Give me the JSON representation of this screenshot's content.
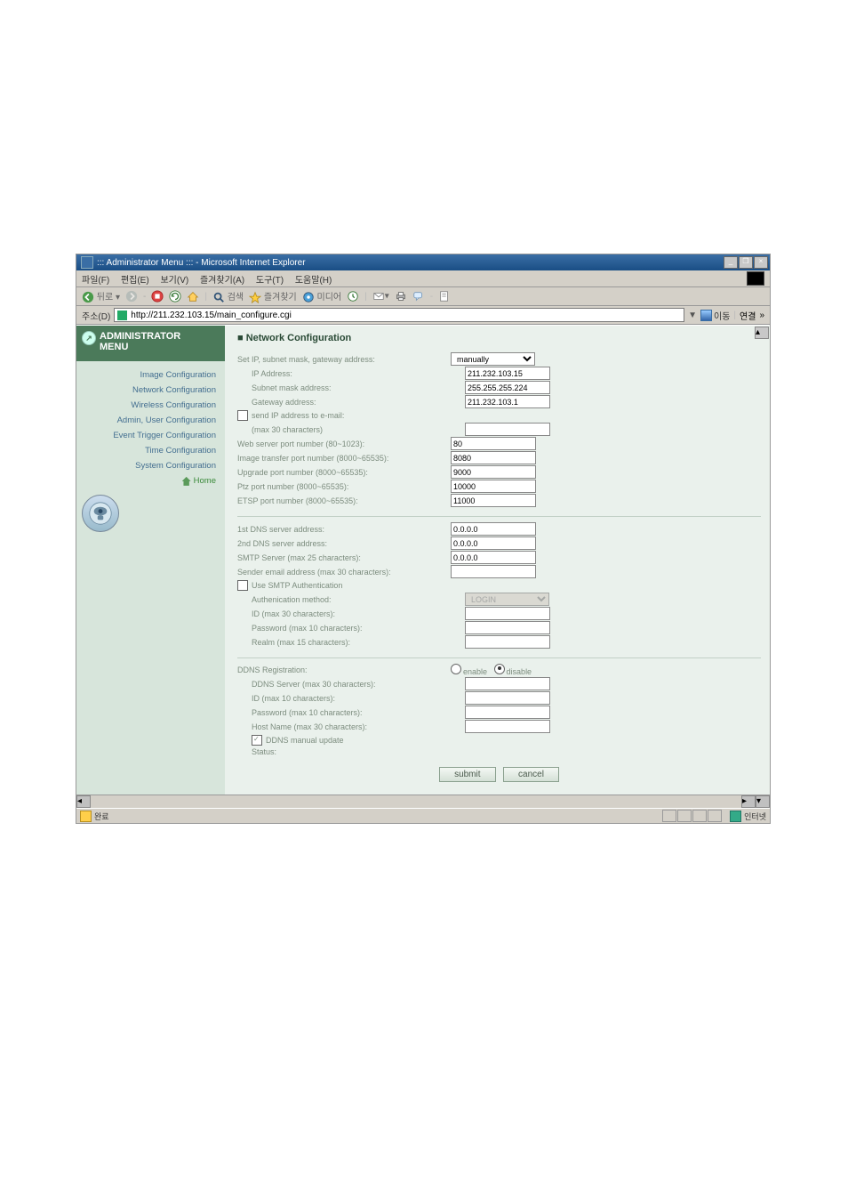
{
  "window": {
    "title": "::: Administrator Menu ::: - Microsoft Internet Explorer",
    "minimize": "_",
    "maximize": "❐",
    "close": "×"
  },
  "menu": {
    "file": "파일(F)",
    "edit": "편집(E)",
    "view": "보기(V)",
    "favorites": "즐겨찾기(A)",
    "tools": "도구(T)",
    "help": "도움말(H)"
  },
  "toolbar": {
    "back": "뒤로",
    "search": "검색",
    "favorites": "즐겨찾기",
    "media": "미디어"
  },
  "address": {
    "label": "주소(D)",
    "url": "http://211.232.103.15/main_configure.cgi",
    "go": "이동",
    "links": "연결"
  },
  "sidebar": {
    "admin_title": "ADMINISTRATOR",
    "admin_menu": "MENU",
    "items": [
      "Image Configuration",
      "Network Configuration",
      "Wireless Configuration",
      "Admin, User Configuration",
      "Event Trigger Configuration",
      "Time Configuration",
      "System Configuration"
    ],
    "home": "Home"
  },
  "page": {
    "title": "■ Network Configuration",
    "grp1": {
      "set_ip": "Set IP, subnet mask, gateway address:",
      "set_ip_mode": "manually",
      "ip_label": "IP Address:",
      "ip_val": "211.232.103.15",
      "subnet_label": "Subnet mask address:",
      "subnet_val": "255.255.255.224",
      "gateway_label": "Gateway address:",
      "gateway_val": "211.232.103.1",
      "send_ip_chk": "send IP address to e-mail:",
      "send_ip_sub": "(max 30 characters)",
      "web_port": "Web server port number (80~1023):",
      "web_port_val": "80",
      "img_port": "Image transfer port number (8000~65535):",
      "img_port_val": "8080",
      "upg_port": "Upgrade port number (8000~65535):",
      "upg_port_val": "9000",
      "ptz_port": "Ptz port number (8000~65535):",
      "ptz_port_val": "10000",
      "etsp_port": "ETSP port number (8000~65535):",
      "etsp_port_val": "11000"
    },
    "grp2": {
      "dns1": "1st DNS server address:",
      "dns1_val": "0.0.0.0",
      "dns2": "2nd DNS server address:",
      "dns2_val": "0.0.0.0",
      "smtp": "SMTP Server (max 25 characters):",
      "smtp_val": "0.0.0.0",
      "sender": "Sender email address (max 30 characters):",
      "sender_val": "",
      "use_smtp": "Use SMTP Authentication",
      "auth_method": "Authenication method:",
      "auth_method_val": "LOGIN",
      "smtp_id": "ID (max 30 characters):",
      "smtp_id_val": "",
      "smtp_pw": "Password (max 10 characters):",
      "smtp_pw_val": "",
      "smtp_realm": "Realm (max 15 characters):",
      "smtp_realm_val": ""
    },
    "grp3": {
      "ddns_reg": "DDNS Registration:",
      "enable": "enable",
      "disable": "disable",
      "ddns_server": "DDNS Server (max 30 characters):",
      "ddns_server_val": "",
      "ddns_id": "ID (max 10 characters):",
      "ddns_id_val": "",
      "ddns_pw": "Password (max 10 characters):",
      "ddns_pw_val": "",
      "ddns_host": "Host Name (max 30 characters):",
      "ddns_host_val": "",
      "ddns_manual": "DDNS manual update",
      "ddns_status": "Status:"
    },
    "btn_submit": "submit",
    "btn_cancel": "cancel"
  },
  "status": {
    "done": "완료",
    "zone": "인터넷"
  }
}
